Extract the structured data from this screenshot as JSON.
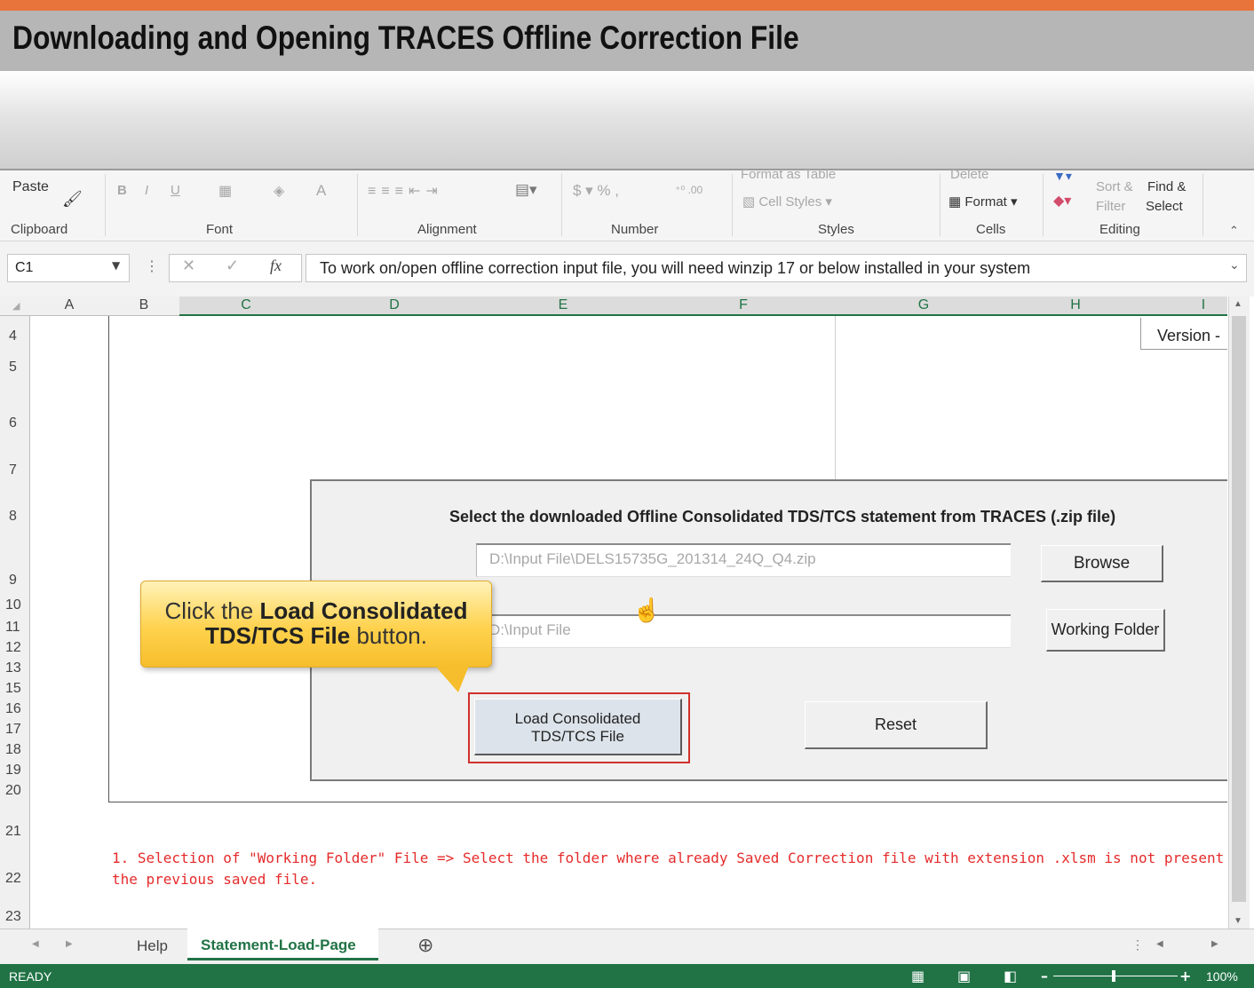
{
  "banner": {
    "title": "Downloading and Opening TRACES Offline Correction File"
  },
  "ribbon": {
    "paste": "Paste",
    "format_as_table": "Format as Table",
    "cell_styles": "Cell Styles",
    "delete": "Delete",
    "format": "Format",
    "sort_filter_1": "Sort &",
    "sort_filter_2": "Filter",
    "find_select_1": "Find &",
    "find_select_2": "Select",
    "groups": {
      "clipboard": "Clipboard",
      "font": "Font",
      "alignment": "Alignment",
      "number": "Number",
      "styles": "Styles",
      "cells": "Cells",
      "editing": "Editing"
    }
  },
  "formula_bar": {
    "name_box": "C1",
    "fx_label": "fx",
    "formula": "To work on/open offline correction input file, you will need winzip 17 or below installed in your system"
  },
  "columns": [
    "A",
    "B",
    "C",
    "D",
    "E",
    "F",
    "G",
    "H",
    "I"
  ],
  "rows": [
    "4",
    "5",
    "6",
    "7",
    "8",
    "9",
    "10",
    "11",
    "12",
    "13",
    "15",
    "16",
    "17",
    "18",
    "19",
    "20",
    "21",
    "22",
    "23"
  ],
  "sheet": {
    "version_label": "Version -",
    "panel_title": "Select the downloaded Offline Consolidated TDS/TCS statement from TRACES (.zip file)",
    "zip_path": "D:\\Input File\\DELS15735G_201314_24Q_Q4.zip",
    "browse": "Browse",
    "folder_path": "D:\\Input File",
    "working_folder": "Working Folder",
    "load_line1": "Load Consolidated",
    "load_line2": "TDS/TCS File",
    "reset": "Reset",
    "note_line1": "1. Selection of \"Working Folder\" File => Select the folder where already Saved Correction file with extension .xlsm is not present or delete",
    "note_line2": "the previous saved file."
  },
  "callout": {
    "text1": "Click the ",
    "bold1": "Load Consolidated",
    "bold2": "TDS/TCS File",
    "text2": " button."
  },
  "tabs": {
    "help": "Help",
    "active": "Statement-Load-Page"
  },
  "status": {
    "ready": "READY",
    "zoom": "100%"
  },
  "colors": {
    "excel_green": "#217346",
    "callout_yellow": "#ffd24d",
    "highlight_red": "#d0312d",
    "banner_orange": "#e8743b"
  }
}
